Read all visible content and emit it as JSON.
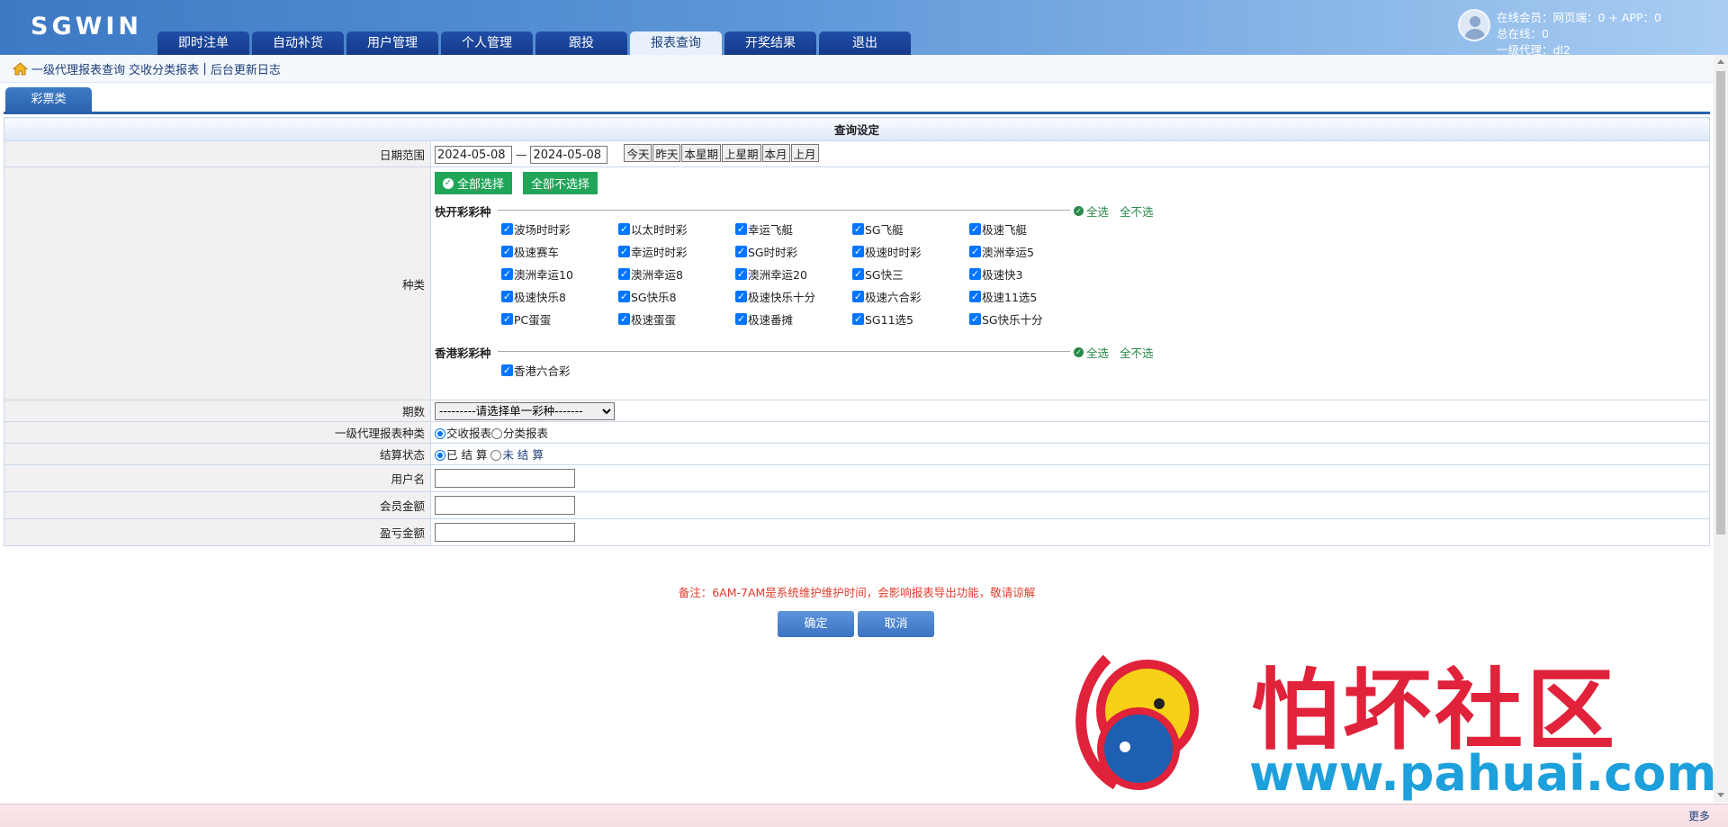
{
  "app": {
    "title": "SGWIN"
  },
  "nav": {
    "tabs": [
      "即时注单",
      "自动补货",
      "用户管理",
      "个人管理",
      "跟投",
      "报表查询",
      "开奖结果",
      "退出"
    ],
    "active": "报表查询"
  },
  "user": {
    "online": "在线会员：网页端：0 + APP：0",
    "total": "总在线：0",
    "agent": "一级代理：dl2"
  },
  "breadcrumb": {
    "current": "一级代理报表查询",
    "link1": "交收分类报表",
    "sep": "|",
    "link2": "后台更新日志"
  },
  "category_tab": "彩票类",
  "form": {
    "caption": "查询设定",
    "date_label": "日期范围",
    "date_from": "2024-05-08",
    "date_sep": "—",
    "date_to": "2024-05-08",
    "quick_dates": [
      "今天",
      "昨天",
      "本星期",
      "上星期",
      "本月",
      "上月"
    ],
    "type_label": "种类",
    "select_all": "全部选择",
    "deselect_all": "全部不选择",
    "groups": [
      {
        "title": "快开彩彩种",
        "sel_all": "全选",
        "sel_none": "全不选",
        "items": [
          "波场时时彩",
          "以太时时彩",
          "幸运飞艇",
          "SG飞艇",
          "极速飞艇",
          "极速赛车",
          "幸运时时彩",
          "SG时时彩",
          "极速时时彩",
          "澳洲幸运5",
          "澳洲幸运10",
          "澳洲幸运8",
          "澳洲幸运20",
          "SG快三",
          "极速快3",
          "极速快乐8",
          "SG快乐8",
          "极速快乐十分",
          "极速六合彩",
          "极速11选5",
          "PC蛋蛋",
          "极速蛋蛋",
          "极速番摊",
          "SG11选5",
          "SG快乐十分"
        ]
      },
      {
        "title": "香港彩彩种",
        "sel_all": "全选",
        "sel_none": "全不选",
        "items": [
          "香港六合彩"
        ]
      }
    ],
    "period_label": "期数",
    "period_value": "---------请选择单一彩种-------",
    "report_label": "一级代理报表种类",
    "report_opt1": "交收报表",
    "report_opt2": "分类报表",
    "settle_label": "结算状态",
    "settle_opt1": "已 结 算",
    "settle_opt2": "未 结 算",
    "username_label": "用户名",
    "member_amount_label": "会员金额",
    "profit_label": "盈亏金额"
  },
  "note": "备注：6AM-7AM是系统维护维护时间，会影响报表导出功能，敬请谅解",
  "buttons": {
    "confirm": "确定",
    "cancel": "取消"
  },
  "footer": {
    "more": "更多"
  },
  "watermark": {
    "title": "怕坏社区",
    "url": "www.pahuai.com"
  },
  "colors": {
    "header": "#3d79c4",
    "nav_tab": "#1f4fa8",
    "green": "#21a559",
    "note": "#e03c2c",
    "watermark_red": "#e0223a",
    "watermark_blue": "#1da0dc"
  }
}
